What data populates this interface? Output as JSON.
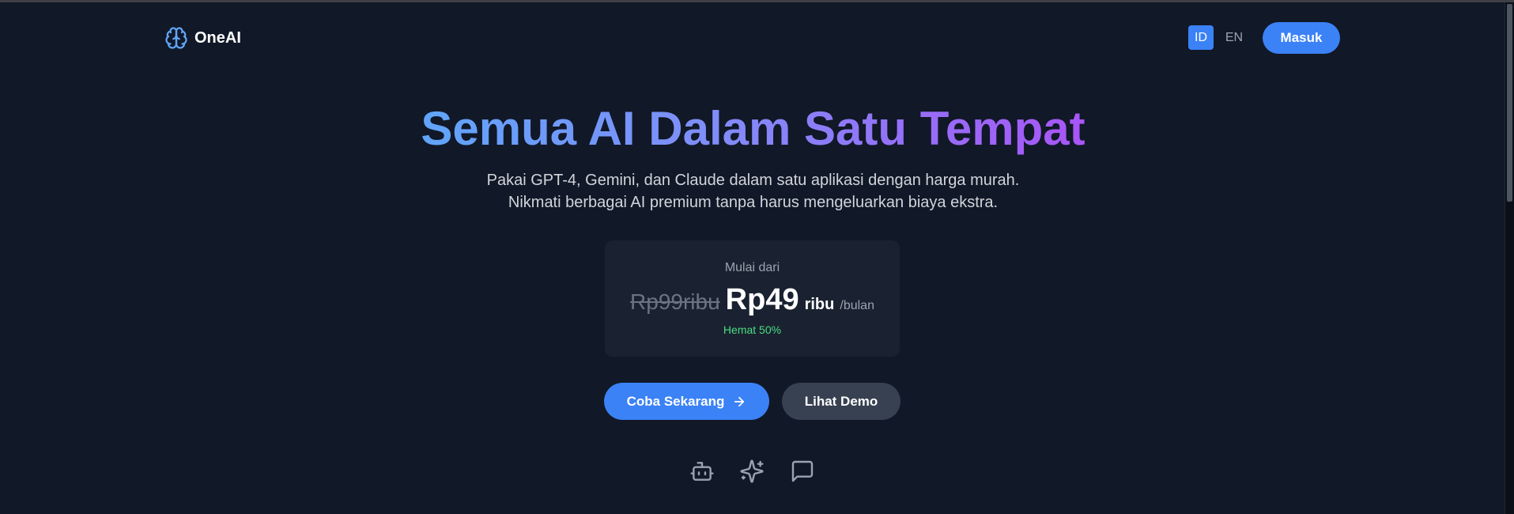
{
  "brand": {
    "name": "OneAI",
    "icon": "brain-icon",
    "accent": "#3b82f6"
  },
  "nav": {
    "lang_id": "ID",
    "lang_en": "EN",
    "login_label": "Masuk",
    "active_lang": "ID"
  },
  "hero": {
    "title": "Semua AI Dalam Satu Tempat",
    "subtitle_line1": "Pakai GPT-4, Gemini, dan Claude dalam satu aplikasi dengan harga murah.",
    "subtitle_line2": "Nikmati berbagai AI premium tanpa harus mengeluarkan biaya ekstra."
  },
  "pricing": {
    "from_label": "Mulai dari",
    "old_price": "Rp99ribu",
    "new_price": "Rp49",
    "unit": "ribu",
    "period": "/bulan",
    "savings": "Hemat 50%",
    "savings_color": "#4ade80"
  },
  "cta": {
    "primary_label": "Coba Sekarang",
    "primary_icon": "arrow-right-icon",
    "secondary_label": "Lihat Demo"
  },
  "features": {
    "icons": [
      "robot-icon",
      "sparkles-icon",
      "chat-bubble-icon"
    ]
  }
}
